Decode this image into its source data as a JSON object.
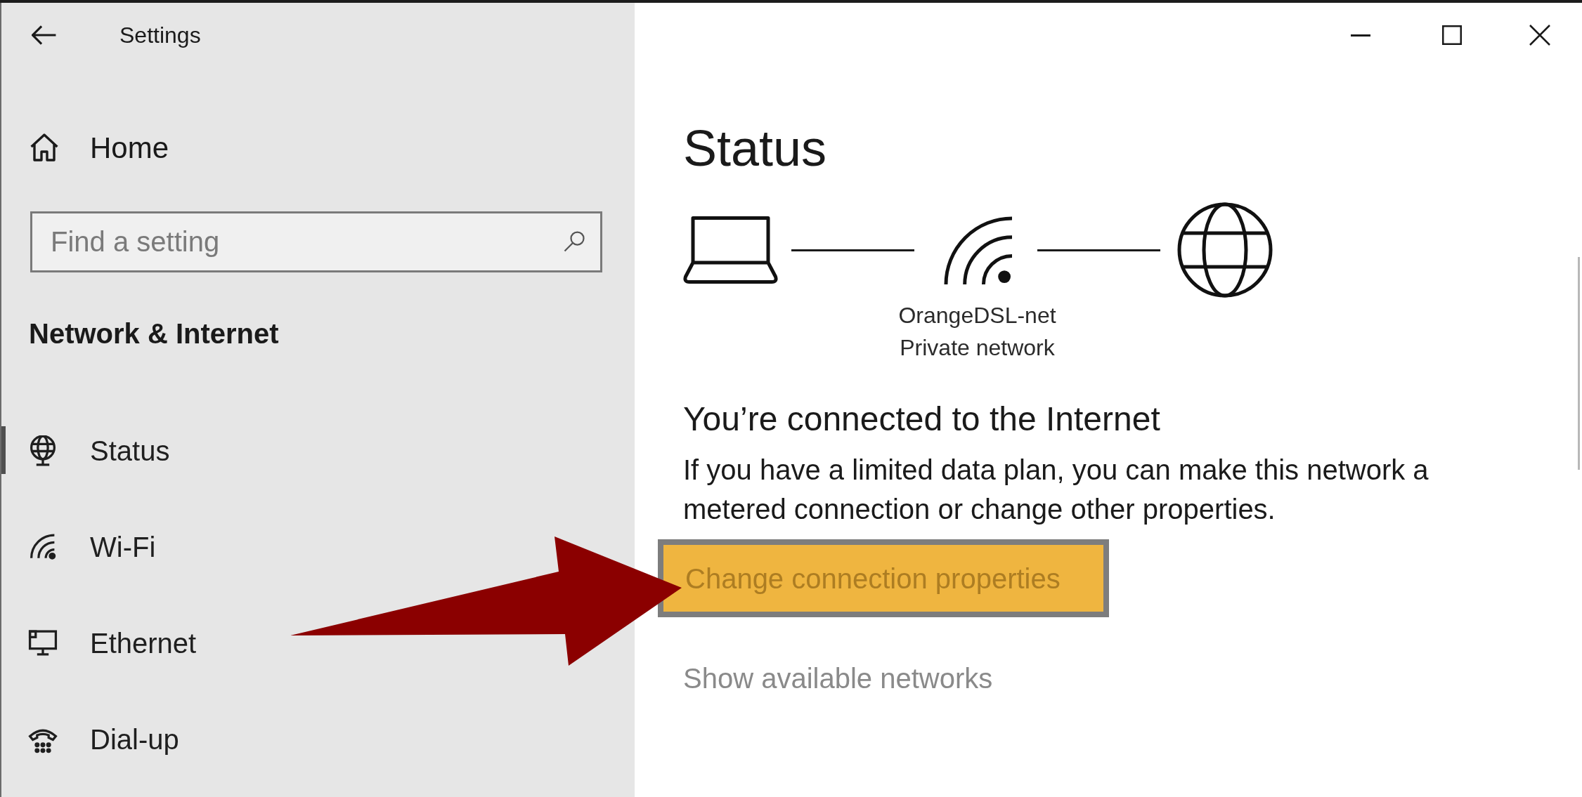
{
  "window": {
    "title": "Settings"
  },
  "sidebar": {
    "home": {
      "label": "Home"
    },
    "search": {
      "placeholder": "Find a setting"
    },
    "section_title": "Network & Internet",
    "items": [
      {
        "label": "Status",
        "selected": true
      },
      {
        "label": "Wi-Fi",
        "selected": false
      },
      {
        "label": "Ethernet",
        "selected": false
      },
      {
        "label": "Dial-up",
        "selected": false
      }
    ]
  },
  "page": {
    "title": "Status",
    "network": {
      "name": "OrangeDSL-net",
      "type": "Private network"
    },
    "heading": "You’re connected to the Internet",
    "description": "If you have a limited data plan, you can make this network a metered connection or change other properties.",
    "links": [
      {
        "label": "Change connection properties",
        "highlighted": true
      },
      {
        "label": "Show available networks",
        "highlighted": false
      }
    ]
  }
}
